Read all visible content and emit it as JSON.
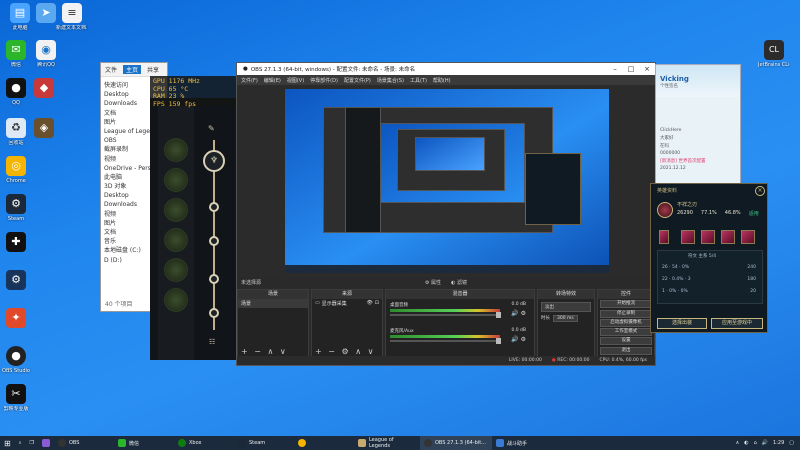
{
  "desktop": {
    "icons_left": [
      {
        "label": "此电脑",
        "icon": "computer-icon",
        "color": "#4aa3ff"
      },
      {
        "label": "",
        "icon": "dove-icon",
        "color": "#5aa9f0"
      },
      {
        "label": "新建文本文档.txt",
        "icon": "text-file-icon",
        "color": "#f2f2f2"
      },
      {
        "label": "微信",
        "icon": "wechat-icon",
        "color": "#2ab52a"
      },
      {
        "label": "腾讯QQ",
        "icon": "qq-icon",
        "color": "#f2f2f2"
      },
      {
        "label": "QQ",
        "icon": "qq-penguin-icon",
        "color": "#111111"
      },
      {
        "label": "",
        "icon": "game-icon",
        "color": "#c83a3a"
      },
      {
        "label": "回收站",
        "icon": "recycle-bin-icon",
        "color": "#dfe9f5"
      },
      {
        "label": "",
        "icon": "game2-icon",
        "color": "#6a4f2d"
      },
      {
        "label": "Chrome",
        "icon": "chrome-icon",
        "color": "#f4b400"
      },
      {
        "label": "Steam",
        "icon": "steam-icon",
        "color": "#1b2838"
      },
      {
        "label": "",
        "icon": "gamepad-icon",
        "color": "#111111"
      },
      {
        "label": "",
        "icon": "steam2-icon",
        "color": "#18345a"
      },
      {
        "label": "",
        "icon": "map-icon",
        "color": "#e04a2a"
      },
      {
        "label": "OBS Studio",
        "icon": "obs-icon",
        "color": "#222222"
      },
      {
        "label": "剪映专业版",
        "icon": "capcut-icon",
        "color": "#111111"
      }
    ],
    "icon_right": {
      "label": "JetBrains CLion",
      "icon": "clion-icon",
      "color": "#2b2b2b"
    }
  },
  "explorer": {
    "tabs": [
      "文件",
      "主页",
      "共享"
    ],
    "tree": [
      "快速访问",
      "Desktop",
      "Downloads",
      "文档",
      "图片",
      "League of Legends",
      "OBS",
      "截屏录制",
      "视频",
      "OneDrive - Personal",
      "此电脑",
      "3D 对象",
      "Desktop",
      "Downloads",
      "视频",
      "图片",
      "文档",
      "音乐",
      "本地磁盘 (C:)",
      "D (D:)"
    ],
    "status": "40 个项目"
  },
  "overlay": {
    "lines": [
      "GPU 1176 MHz",
      "CPU 65 °C",
      "RAM 23 %",
      "FPS 159 fps"
    ]
  },
  "obs": {
    "title": "OBS 27.1.3 (64-bit, windows) - 配置文件: 未命名 - 场景: 未命名",
    "menu": [
      "文件(F)",
      "编辑(E)",
      "视图(V)",
      "停靠部件(D)",
      "配置文件(P)",
      "场景集合(S)",
      "工具(T)",
      "帮助(H)"
    ],
    "no_source": "未选择源",
    "dock_tabs": [
      "属性",
      "滤镜"
    ],
    "docks": {
      "scenes": "场景",
      "sources": "来源",
      "mixer": "混音器",
      "transitions": "转场特效",
      "controls": "控件"
    },
    "scene_item": "场景",
    "source_item": "显示器采集",
    "mixer_tracks": [
      {
        "name": "桌面音频",
        "db": "0.0 dB"
      },
      {
        "name": "麦克风/Aux",
        "db": "0.0 dB"
      }
    ],
    "transition": {
      "type": "淡出",
      "duration_label": "时长",
      "duration": "300 ms"
    },
    "controls": [
      "开始推流",
      "停止录制",
      "启动虚拟摄像机",
      "工作室模式",
      "设置",
      "退出"
    ],
    "status": {
      "live": "LIVE: 00:00:00",
      "rec": "REC: 00:00:00",
      "cpu": "CPU: 0.4%, 60.00 fps"
    }
  },
  "qq": {
    "name": "Vicking",
    "subtitle": "个性签名",
    "chat": [
      "ClickHere",
      "大家好",
      "在吗",
      "0000000",
      "[新消息] 世界首次配置",
      "2021.12.12"
    ]
  },
  "build": {
    "header": "英雄资料",
    "champion": "不祥之刃",
    "games": "26290",
    "winrate": "77.1%",
    "pickrate": "46.8%",
    "tag": "适用",
    "rune_label": "符文 主系 5/4",
    "rune_rows": [
      "26 · 54 · 0%",
      "22 · 0.4% · 3",
      "1 · 0% · 0%"
    ],
    "rune_right": [
      "240",
      "180",
      "20"
    ],
    "btn_select": "选择出装",
    "btn_auto": "应用至游戏中"
  },
  "taskbar": {
    "apps": [
      "OBS",
      "微信",
      "Xbox",
      "Steam",
      "",
      "League of Legends",
      "OBS 27.1.3 (64-bit...",
      "战斗助手"
    ],
    "time": "1:29"
  }
}
